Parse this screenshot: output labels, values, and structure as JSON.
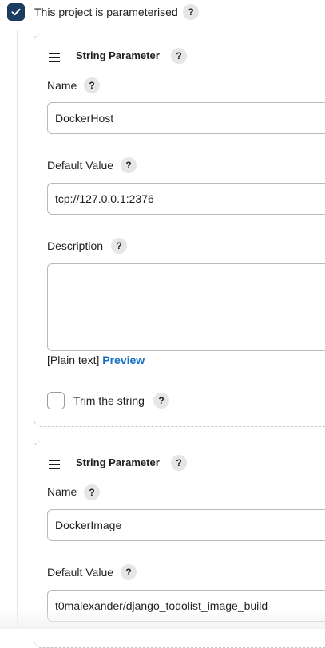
{
  "parameterised": {
    "label": "This project is parameterised",
    "checked": true
  },
  "help_glyph": "?",
  "parameters": [
    {
      "header": "String Parameter",
      "name_label": "Name",
      "name_value": "DockerHost",
      "default_label": "Default Value",
      "default_value": "tcp://127.0.0.1:2376",
      "description_label": "Description",
      "description_value": "",
      "format_note": "[Plain text]",
      "preview_link": "Preview",
      "trim_label": "Trim the string",
      "trim_checked": false
    },
    {
      "header": "String Parameter",
      "name_label": "Name",
      "name_value": "DockerImage",
      "default_label": "Default Value",
      "default_value": "t0malexander/django_todolist_image_build"
    }
  ],
  "colors": {
    "checkbox_checked": "#1b3b5f",
    "link": "#1670c2",
    "border": "#b9b9b9"
  }
}
